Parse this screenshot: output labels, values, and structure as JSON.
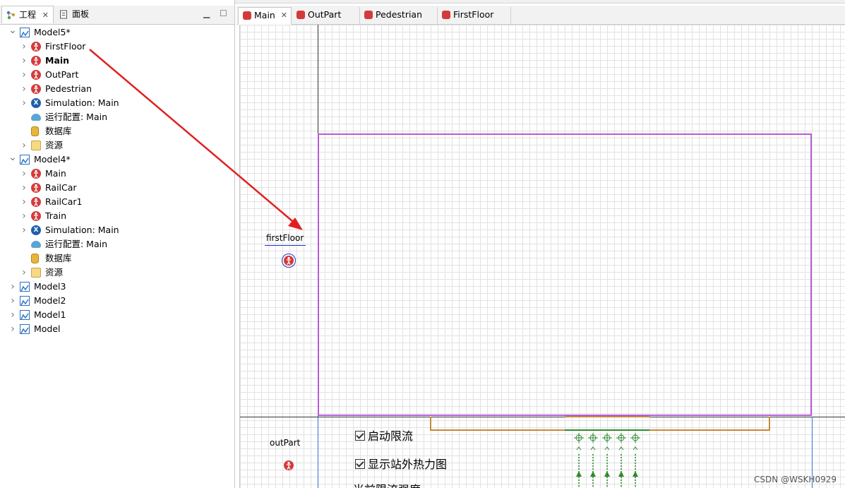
{
  "left_tabs": [
    {
      "label": "工程",
      "icon": "project-icon",
      "active": true
    },
    {
      "label": "面板",
      "icon": "palette-icon",
      "active": false
    }
  ],
  "tree": [
    {
      "label": "Model5*",
      "icon": "model-icon",
      "level": 0,
      "expanded": true,
      "bold": false
    },
    {
      "label": "FirstFloor",
      "icon": "pedestrian-agent-icon",
      "level": 1,
      "expanded": false,
      "bold": false
    },
    {
      "label": "Main",
      "icon": "pedestrian-agent-icon",
      "level": 1,
      "expanded": false,
      "bold": true
    },
    {
      "label": "OutPart",
      "icon": "pedestrian-agent-icon",
      "level": 1,
      "expanded": false,
      "bold": false
    },
    {
      "label": "Pedestrian",
      "icon": "pedestrian-agent-icon",
      "level": 1,
      "expanded": false,
      "bold": false
    },
    {
      "label": "Simulation: Main",
      "icon": "simulation-icon",
      "level": 1,
      "expanded": false,
      "bold": false
    },
    {
      "label": "运行配置: Main",
      "icon": "run-config-icon",
      "level": 1,
      "expanded": null,
      "bold": false
    },
    {
      "label": "数据库",
      "icon": "database-icon",
      "level": 1,
      "expanded": null,
      "bold": false
    },
    {
      "label": "资源",
      "icon": "folder-icon",
      "level": 1,
      "expanded": false,
      "bold": false
    },
    {
      "label": "Model4*",
      "icon": "model-icon",
      "level": 0,
      "expanded": true,
      "bold": false
    },
    {
      "label": "Main",
      "icon": "pedestrian-agent-icon",
      "level": 1,
      "expanded": false,
      "bold": false
    },
    {
      "label": "RailCar",
      "icon": "pedestrian-agent-icon",
      "level": 1,
      "expanded": false,
      "bold": false
    },
    {
      "label": "RailCar1",
      "icon": "pedestrian-agent-icon",
      "level": 1,
      "expanded": false,
      "bold": false
    },
    {
      "label": "Train",
      "icon": "pedestrian-agent-icon",
      "level": 1,
      "expanded": false,
      "bold": false
    },
    {
      "label": "Simulation: Main",
      "icon": "simulation-icon",
      "level": 1,
      "expanded": false,
      "bold": false
    },
    {
      "label": "运行配置: Main",
      "icon": "run-config-icon",
      "level": 1,
      "expanded": null,
      "bold": false
    },
    {
      "label": "数据库",
      "icon": "database-icon",
      "level": 1,
      "expanded": null,
      "bold": false
    },
    {
      "label": "资源",
      "icon": "folder-icon",
      "level": 1,
      "expanded": false,
      "bold": false
    },
    {
      "label": "Model3",
      "icon": "model-icon",
      "level": 0,
      "expanded": false,
      "bold": false
    },
    {
      "label": "Model2",
      "icon": "model-icon",
      "level": 0,
      "expanded": false,
      "bold": false
    },
    {
      "label": "Model1",
      "icon": "model-icon",
      "level": 0,
      "expanded": false,
      "bold": false
    },
    {
      "label": "Model",
      "icon": "model-icon",
      "level": 0,
      "expanded": false,
      "bold": false
    }
  ],
  "editor_tabs": [
    {
      "label": "Main",
      "active": true,
      "closable": true
    },
    {
      "label": "OutPart",
      "active": false,
      "closable": false
    },
    {
      "label": "Pedestrian",
      "active": false,
      "closable": false
    },
    {
      "label": "FirstFloor",
      "active": false,
      "closable": false
    }
  ],
  "canvas": {
    "first_floor_label": "firstFloor",
    "out_part_label": "outPart",
    "checkbox_1": "启动限流",
    "checkbox_2": "显示站外热力图",
    "partial_text": "当前限流强度"
  },
  "colors": {
    "room_border": "#b85cd6",
    "arrow": "#e02020",
    "agent_icon": "#d33b3b",
    "gate_green": "#2e8b2e",
    "rail_orange": "#c8893a"
  },
  "watermark": "CSDN @WSKH0929"
}
